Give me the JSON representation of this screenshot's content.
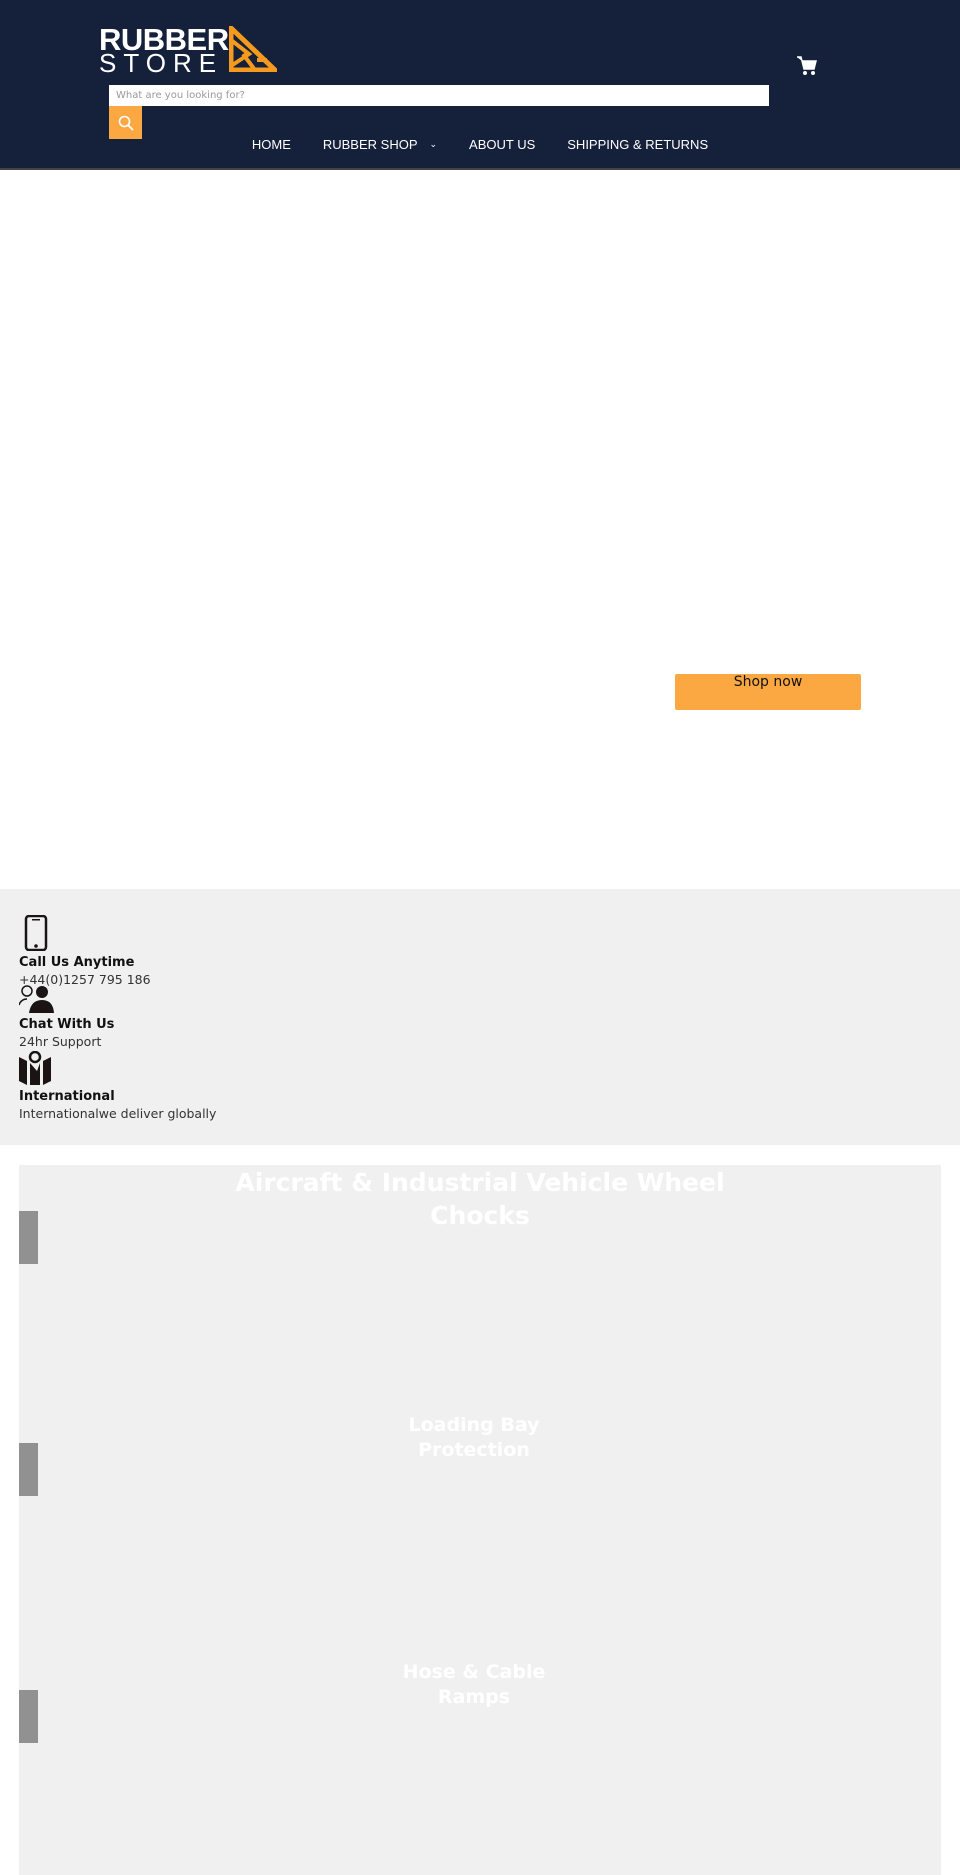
{
  "header": {
    "logo_text": "RUBBER STORE",
    "logo_line1": "RUBBER",
    "logo_line2": "STORE",
    "search_placeholder": "What are you looking for?",
    "nav": [
      {
        "label": "HOME"
      },
      {
        "label": "RUBBER SHOP",
        "has_dropdown": true
      },
      {
        "label": "ABOUT US"
      },
      {
        "label": "SHIPPING & RETURNS"
      }
    ],
    "icons": {
      "search": "search-icon",
      "cart": "cart-icon",
      "dropdown": "chevron-down-icon"
    }
  },
  "hero": {
    "button_label": "Shop now"
  },
  "info": [
    {
      "icon": "phone-icon",
      "title": "Call Us Anytime",
      "text": "+44(0)1257 795 186"
    },
    {
      "icon": "users-icon",
      "title": "Chat With Us",
      "text": "24hr Support"
    },
    {
      "icon": "map-icon",
      "title": "International",
      "text": "Internationalwe deliver globally"
    }
  ],
  "categories": [
    {
      "line1": "Aircraft & Industrial Vehicle Wheel",
      "line2": "Chocks"
    },
    {
      "line1": "Loading Bay",
      "line2": "Protection"
    },
    {
      "line1": "Hose & Cable",
      "line2": "Ramps"
    }
  ],
  "colors": {
    "header_bg": "#15203a",
    "accent": "#fba843",
    "info_bg": "#f0f0f0"
  }
}
